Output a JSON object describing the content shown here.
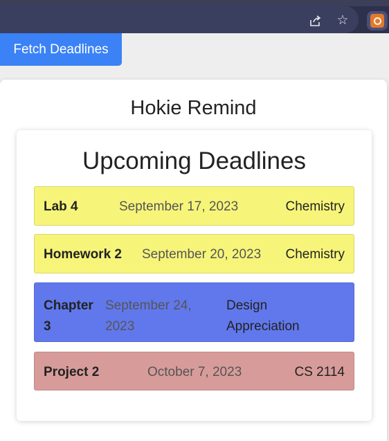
{
  "browser": {
    "icons": [
      "share-icon",
      "star-icon",
      "extension-icon"
    ]
  },
  "fetch_button_label": "Fetch Deadlines",
  "app_title": "Hokie Remind",
  "deadlines_heading": "Upcoming Deadlines",
  "colors": {
    "button": "#3b82f6",
    "yellow": "#f6f57a",
    "blue": "#6178ec",
    "red": "#d79c9a"
  },
  "deadlines": [
    {
      "name": "Lab 4",
      "date": "September 17, 2023",
      "course": "Chemistry",
      "color": "yellow"
    },
    {
      "name": "Homework 2",
      "date": "September 20, 2023",
      "course": "Chemistry",
      "color": "yellow"
    },
    {
      "name": "Chapter 3",
      "date": "September 24, 2023",
      "course": "Design Appreciation",
      "color": "blue"
    },
    {
      "name": "Project 2",
      "date": "October 7, 2023",
      "course": "CS 2114",
      "color": "red"
    }
  ]
}
